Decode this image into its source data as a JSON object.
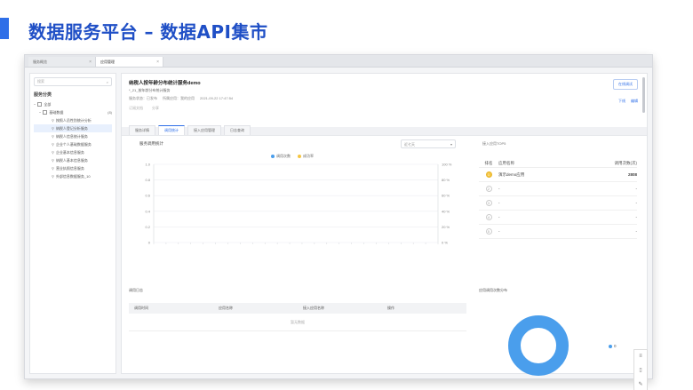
{
  "slide": {
    "title": "数据服务平台 – 数据API集市"
  },
  "browser_tabs": [
    {
      "label": "服务概览"
    },
    {
      "label": "应用管理"
    }
  ],
  "sidebar": {
    "search_placeholder": "搜索",
    "section_title": "服务分类",
    "items": [
      {
        "label": "全部"
      },
      {
        "label": "基础数据",
        "count": "(8)"
      },
      {
        "label": "按照人员性别统计分析"
      },
      {
        "label": "纳税人登记分析服务"
      },
      {
        "label": "纳税人信息统计服务"
      },
      {
        "label": "企业个人基础数据服务"
      },
      {
        "label": "企业基本信息服务"
      },
      {
        "label": "纳税人基本信息服务"
      },
      {
        "label": "营业执照信息服务"
      },
      {
        "label": "外部信息数据服务_10"
      }
    ]
  },
  "service": {
    "name": "纳税人按年龄分布统计服务demo",
    "subtitle": "*_21_按年龄分布统计服务",
    "meta": [
      "服务状态：已发布",
      "所属应用：我的应用",
      "2021-09-22 17:47:54"
    ],
    "actions": [
      "订阅文档",
      "分享"
    ],
    "top_button": "在线调试",
    "links": [
      "下线",
      "编辑"
    ]
  },
  "tabs": [
    {
      "label": "服务详情"
    },
    {
      "label": "调用统计"
    },
    {
      "label": "接入应用管理"
    },
    {
      "label": "日志查询"
    }
  ],
  "stats": {
    "chart_title": "服务调用统计",
    "date_select": "近七天",
    "log_title": "调用日志",
    "table_headers": [
      "调用时间",
      "应用名称",
      "接入应用名称",
      "操作"
    ],
    "table_empty": "暂无数据",
    "rank_select": "接入应用TOP5",
    "rank_headers": [
      "排名",
      "应用名称",
      "调用次数(次)"
    ],
    "rank_rows": [
      {
        "rank": "1",
        "app": "演示demo应用",
        "num": "2808"
      },
      {
        "rank": "2",
        "app": "-",
        "num": "-"
      },
      {
        "rank": "3",
        "app": "-",
        "num": "-"
      },
      {
        "rank": "4",
        "app": "-",
        "num": "-"
      },
      {
        "rank": "5",
        "app": "-",
        "num": "-"
      }
    ],
    "dist_title": "应用调用次数分布",
    "dist_legend": "0",
    "colors": {
      "accent": "#2f6fe8",
      "series1": "#4a9eec",
      "series2": "#f5c542"
    }
  },
  "chart_data": {
    "type": "line",
    "title": "服务调用统计",
    "series": [
      {
        "name": "调用次数",
        "values": []
      },
      {
        "name": "成功率",
        "values": []
      }
    ],
    "y_left_ticks": [
      "1.0",
      "0.8",
      "0.6",
      "0.4",
      "0.2",
      "0"
    ],
    "y_right_ticks": [
      "100 %",
      "80 %",
      "60 %",
      "40 %",
      "20 %",
      "0 %"
    ],
    "x_tick_count": 24,
    "grid": true,
    "legend": "top-center"
  }
}
